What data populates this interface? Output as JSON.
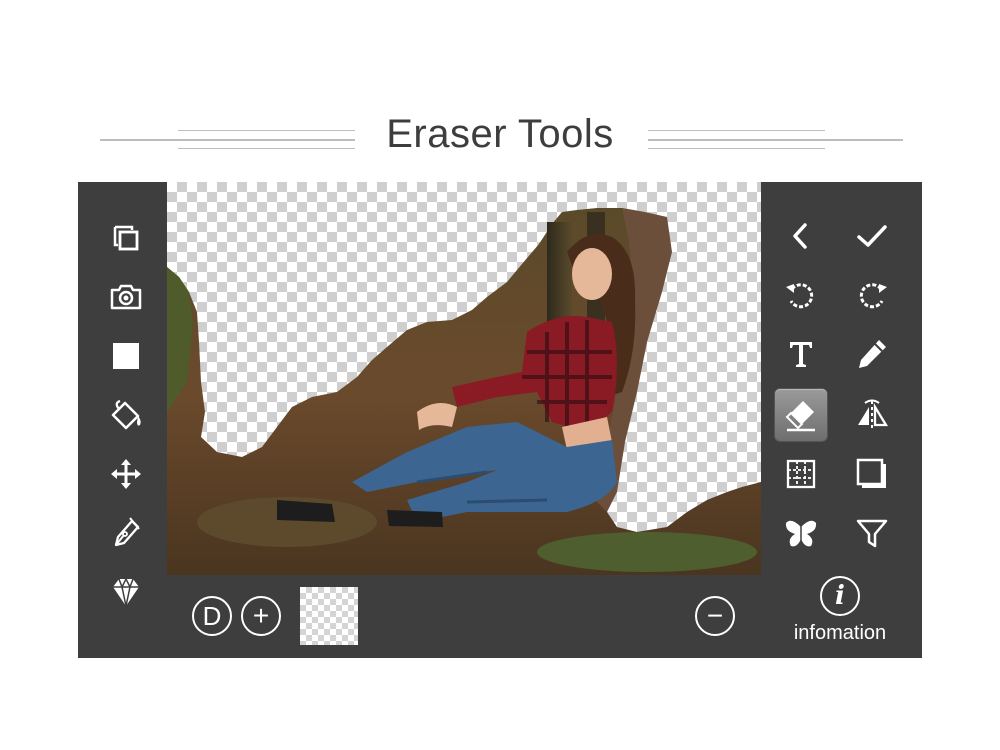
{
  "title": "Eraser Tools",
  "left_toolbar": [
    {
      "icon": "copy-layers-icon"
    },
    {
      "icon": "camera-icon"
    },
    {
      "icon": "white-square-icon"
    },
    {
      "icon": "paint-bucket-icon"
    },
    {
      "icon": "move-arrows-icon"
    },
    {
      "icon": "pen-nib-icon"
    },
    {
      "icon": "diamond-icon"
    }
  ],
  "right_toolbar": [
    {
      "icon": "back-chevron-icon"
    },
    {
      "icon": "checkmark-icon"
    },
    {
      "icon": "undo-icon"
    },
    {
      "icon": "redo-icon"
    },
    {
      "icon": "text-tool-icon"
    },
    {
      "icon": "pencil-icon"
    },
    {
      "icon": "eraser-icon",
      "active": true
    },
    {
      "icon": "flip-icon"
    },
    {
      "icon": "grid-icon"
    },
    {
      "icon": "frame-icon"
    },
    {
      "icon": "butterfly-icon"
    },
    {
      "icon": "filter-funnel-icon"
    }
  ],
  "bottom_bar": {
    "d_label": "D",
    "plus_label": "+",
    "minus_label": "−",
    "info_symbol": "i",
    "info_label": "infomation"
  },
  "colors": {
    "panel": "#3e3e3e",
    "icon": "#ffffff",
    "active_tool": "#8a8a8a",
    "title": "#3d3d3d"
  }
}
